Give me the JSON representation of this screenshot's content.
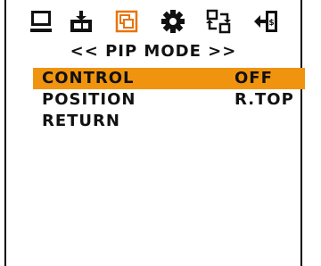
{
  "colors": {
    "highlight": "#f0940f",
    "pip_icon_accent": "#e8740c",
    "text": "#111111",
    "background": "#ffffff"
  },
  "icons": [
    "monitor-icon",
    "input-source-icon",
    "pip-icon",
    "settings-gear-icon",
    "swap-icon",
    "exit-icon"
  ],
  "menu": {
    "title": "<< PIP MODE >>",
    "items": [
      {
        "label": "CONTROL",
        "value": "OFF",
        "selected": true
      },
      {
        "label": "POSITION",
        "value": "R.TOP",
        "selected": false
      },
      {
        "label": "RETURN",
        "value": "",
        "selected": false
      }
    ]
  }
}
